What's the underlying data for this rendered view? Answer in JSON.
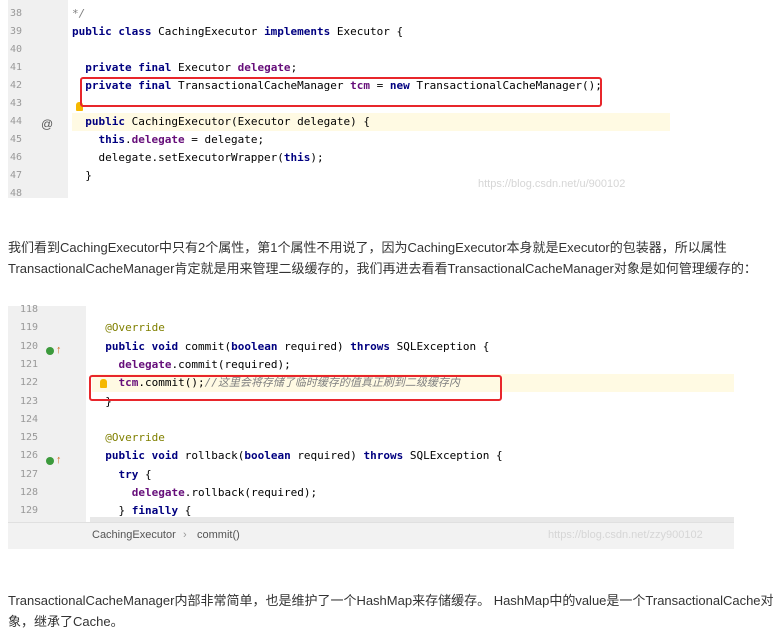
{
  "screenshot1": {
    "lines": [
      {
        "num": "38",
        "parts": [
          {
            "t": "*/",
            "c": "cmt"
          }
        ]
      },
      {
        "num": "39",
        "parts": [
          {
            "t": "public class ",
            "c": "kw"
          },
          {
            "t": "CachingExecutor ",
            "c": ""
          },
          {
            "t": "implements ",
            "c": "kw"
          },
          {
            "t": "Executor {",
            "c": ""
          }
        ]
      },
      {
        "num": "40",
        "parts": []
      },
      {
        "num": "41",
        "parts": [
          {
            "t": "  private final ",
            "c": "kw"
          },
          {
            "t": "Executor ",
            "c": ""
          },
          {
            "t": "delegate",
            "c": "fld"
          },
          {
            "t": ";",
            "c": ""
          }
        ]
      },
      {
        "num": "42",
        "parts": [
          {
            "t": "  private final ",
            "c": "kw"
          },
          {
            "t": "TransactionalCacheManager ",
            "c": ""
          },
          {
            "t": "tcm",
            "c": "fld"
          },
          {
            "t": " = ",
            "c": ""
          },
          {
            "t": "new ",
            "c": "kw"
          },
          {
            "t": "TransactionalCacheManager();",
            "c": ""
          }
        ]
      },
      {
        "num": "43",
        "parts": []
      },
      {
        "num": "44",
        "parts": [
          {
            "t": "  public ",
            "c": "kw"
          },
          {
            "t": "CachingExecutor",
            "c": ""
          },
          {
            "t": "(Executor delegate) {",
            "c": ""
          }
        ]
      },
      {
        "num": "45",
        "parts": [
          {
            "t": "    this",
            "c": "kw"
          },
          {
            "t": ".",
            "c": ""
          },
          {
            "t": "delegate",
            "c": "fld"
          },
          {
            "t": " = delegate;",
            "c": ""
          }
        ]
      },
      {
        "num": "46",
        "parts": [
          {
            "t": "    delegate.setExecutorWrapper(",
            "c": ""
          },
          {
            "t": "this",
            "c": "kw"
          },
          {
            "t": ");",
            "c": ""
          }
        ]
      },
      {
        "num": "47",
        "parts": [
          {
            "t": "  }",
            "c": ""
          }
        ]
      },
      {
        "num": "48",
        "parts": []
      }
    ],
    "gutter_at": "@",
    "watermark": "https://blog.csdn.net/u/900102"
  },
  "paragraph1": "我们看到CachingExecutor中只有2个属性，第1个属性不用说了，因为CachingExecutor本身就是Executor的包装器，所以属性TransactionalCacheManager肯定就是用来管理二级缓存的，我们再进去看看TransactionalCacheManager对象是如何管理缓存的：",
  "screenshot2": {
    "lines": [
      {
        "num": "118",
        "parts": []
      },
      {
        "num": "119",
        "parts": [
          {
            "t": "  @Override",
            "c": "ann"
          }
        ]
      },
      {
        "num": "120",
        "parts": [
          {
            "t": "  public void ",
            "c": "kw"
          },
          {
            "t": "commit(",
            "c": ""
          },
          {
            "t": "boolean ",
            "c": "kw"
          },
          {
            "t": "required) ",
            "c": ""
          },
          {
            "t": "throws ",
            "c": "kw"
          },
          {
            "t": "SQLException {",
            "c": ""
          }
        ]
      },
      {
        "num": "121",
        "parts": [
          {
            "t": "    delegate",
            "c": "fld"
          },
          {
            "t": ".commit(required);",
            "c": ""
          }
        ]
      },
      {
        "num": "122",
        "parts": [
          {
            "t": "    tcm",
            "c": "fld"
          },
          {
            "t": ".commit();",
            "c": ""
          },
          {
            "t": "//这里会将存储了临时缓存的值真正刷到二级缓存内",
            "c": "cmt"
          }
        ]
      },
      {
        "num": "123",
        "parts": [
          {
            "t": "  }",
            "c": ""
          }
        ]
      },
      {
        "num": "124",
        "parts": []
      },
      {
        "num": "125",
        "parts": [
          {
            "t": "  @Override",
            "c": "ann"
          }
        ]
      },
      {
        "num": "126",
        "parts": [
          {
            "t": "  public void ",
            "c": "kw"
          },
          {
            "t": "rollback(",
            "c": ""
          },
          {
            "t": "boolean ",
            "c": "kw"
          },
          {
            "t": "required) ",
            "c": ""
          },
          {
            "t": "throws ",
            "c": "kw"
          },
          {
            "t": "SQLException {",
            "c": ""
          }
        ]
      },
      {
        "num": "127",
        "parts": [
          {
            "t": "    try ",
            "c": "kw"
          },
          {
            "t": "{",
            "c": ""
          }
        ]
      },
      {
        "num": "128",
        "parts": [
          {
            "t": "      delegate",
            "c": "fld"
          },
          {
            "t": ".rollback(required);",
            "c": ""
          }
        ]
      },
      {
        "num": "129",
        "parts": [
          {
            "t": "    } ",
            "c": ""
          },
          {
            "t": "finally ",
            "c": "kw"
          },
          {
            "t": "{",
            "c": ""
          }
        ]
      }
    ],
    "breadcrumb": [
      "CachingExecutor",
      "›",
      "commit()"
    ],
    "watermark": "https://blog.csdn.net/zzy900102"
  },
  "paragraph2": "TransactionalCacheManager内部非常简单，也是维护了一个HashMap来存储缓存。 HashMap中的value是一个TransactionalCache对象，继承了Cache。"
}
